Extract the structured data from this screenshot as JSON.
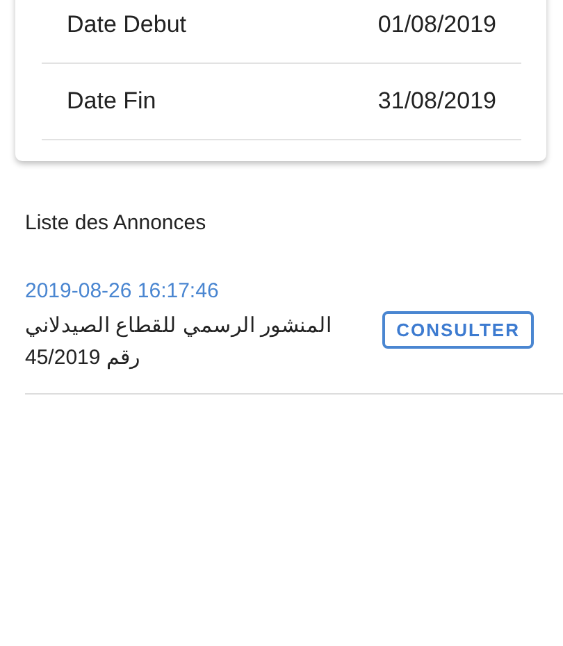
{
  "period": [
    {
      "label": "Date Debut",
      "value": "01/08/2019"
    },
    {
      "label": "Date Fin",
      "value": "31/08/2019"
    }
  ],
  "announcements": {
    "title": "Liste des Annonces",
    "items": [
      {
        "date": "2019-08-26 16:17:46",
        "text": "المنشور الرسمي للقطاع الصيدلاني رقم 45/2019",
        "action": "CONSULTER"
      }
    ]
  }
}
